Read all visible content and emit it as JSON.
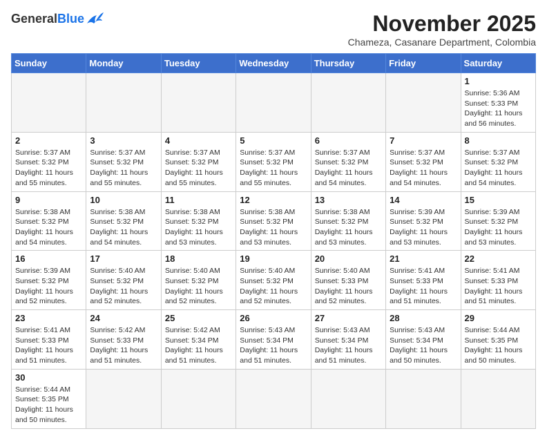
{
  "header": {
    "logo_general": "General",
    "logo_blue": "Blue",
    "month_title": "November 2025",
    "subtitle": "Chameza, Casanare Department, Colombia"
  },
  "weekdays": [
    "Sunday",
    "Monday",
    "Tuesday",
    "Wednesday",
    "Thursday",
    "Friday",
    "Saturday"
  ],
  "weeks": [
    [
      {
        "day": "",
        "empty": true
      },
      {
        "day": "",
        "empty": true
      },
      {
        "day": "",
        "empty": true
      },
      {
        "day": "",
        "empty": true
      },
      {
        "day": "",
        "empty": true
      },
      {
        "day": "",
        "empty": true
      },
      {
        "day": "1",
        "sunrise": "5:36 AM",
        "sunset": "5:33 PM",
        "daylight": "11 hours and 56 minutes."
      }
    ],
    [
      {
        "day": "2",
        "sunrise": "5:37 AM",
        "sunset": "5:32 PM",
        "daylight": "11 hours and 55 minutes."
      },
      {
        "day": "3",
        "sunrise": "5:37 AM",
        "sunset": "5:32 PM",
        "daylight": "11 hours and 55 minutes."
      },
      {
        "day": "4",
        "sunrise": "5:37 AM",
        "sunset": "5:32 PM",
        "daylight": "11 hours and 55 minutes."
      },
      {
        "day": "5",
        "sunrise": "5:37 AM",
        "sunset": "5:32 PM",
        "daylight": "11 hours and 55 minutes."
      },
      {
        "day": "6",
        "sunrise": "5:37 AM",
        "sunset": "5:32 PM",
        "daylight": "11 hours and 54 minutes."
      },
      {
        "day": "7",
        "sunrise": "5:37 AM",
        "sunset": "5:32 PM",
        "daylight": "11 hours and 54 minutes."
      },
      {
        "day": "8",
        "sunrise": "5:37 AM",
        "sunset": "5:32 PM",
        "daylight": "11 hours and 54 minutes."
      }
    ],
    [
      {
        "day": "9",
        "sunrise": "5:38 AM",
        "sunset": "5:32 PM",
        "daylight": "11 hours and 54 minutes."
      },
      {
        "day": "10",
        "sunrise": "5:38 AM",
        "sunset": "5:32 PM",
        "daylight": "11 hours and 54 minutes."
      },
      {
        "day": "11",
        "sunrise": "5:38 AM",
        "sunset": "5:32 PM",
        "daylight": "11 hours and 53 minutes."
      },
      {
        "day": "12",
        "sunrise": "5:38 AM",
        "sunset": "5:32 PM",
        "daylight": "11 hours and 53 minutes."
      },
      {
        "day": "13",
        "sunrise": "5:38 AM",
        "sunset": "5:32 PM",
        "daylight": "11 hours and 53 minutes."
      },
      {
        "day": "14",
        "sunrise": "5:39 AM",
        "sunset": "5:32 PM",
        "daylight": "11 hours and 53 minutes."
      },
      {
        "day": "15",
        "sunrise": "5:39 AM",
        "sunset": "5:32 PM",
        "daylight": "11 hours and 53 minutes."
      }
    ],
    [
      {
        "day": "16",
        "sunrise": "5:39 AM",
        "sunset": "5:32 PM",
        "daylight": "11 hours and 52 minutes."
      },
      {
        "day": "17",
        "sunrise": "5:40 AM",
        "sunset": "5:32 PM",
        "daylight": "11 hours and 52 minutes."
      },
      {
        "day": "18",
        "sunrise": "5:40 AM",
        "sunset": "5:32 PM",
        "daylight": "11 hours and 52 minutes."
      },
      {
        "day": "19",
        "sunrise": "5:40 AM",
        "sunset": "5:32 PM",
        "daylight": "11 hours and 52 minutes."
      },
      {
        "day": "20",
        "sunrise": "5:40 AM",
        "sunset": "5:33 PM",
        "daylight": "11 hours and 52 minutes."
      },
      {
        "day": "21",
        "sunrise": "5:41 AM",
        "sunset": "5:33 PM",
        "daylight": "11 hours and 51 minutes."
      },
      {
        "day": "22",
        "sunrise": "5:41 AM",
        "sunset": "5:33 PM",
        "daylight": "11 hours and 51 minutes."
      }
    ],
    [
      {
        "day": "23",
        "sunrise": "5:41 AM",
        "sunset": "5:33 PM",
        "daylight": "11 hours and 51 minutes."
      },
      {
        "day": "24",
        "sunrise": "5:42 AM",
        "sunset": "5:33 PM",
        "daylight": "11 hours and 51 minutes."
      },
      {
        "day": "25",
        "sunrise": "5:42 AM",
        "sunset": "5:34 PM",
        "daylight": "11 hours and 51 minutes."
      },
      {
        "day": "26",
        "sunrise": "5:43 AM",
        "sunset": "5:34 PM",
        "daylight": "11 hours and 51 minutes."
      },
      {
        "day": "27",
        "sunrise": "5:43 AM",
        "sunset": "5:34 PM",
        "daylight": "11 hours and 51 minutes."
      },
      {
        "day": "28",
        "sunrise": "5:43 AM",
        "sunset": "5:34 PM",
        "daylight": "11 hours and 50 minutes."
      },
      {
        "day": "29",
        "sunrise": "5:44 AM",
        "sunset": "5:35 PM",
        "daylight": "11 hours and 50 minutes."
      }
    ],
    [
      {
        "day": "30",
        "sunrise": "5:44 AM",
        "sunset": "5:35 PM",
        "daylight": "11 hours and 50 minutes."
      },
      {
        "day": "",
        "empty": true
      },
      {
        "day": "",
        "empty": true
      },
      {
        "day": "",
        "empty": true
      },
      {
        "day": "",
        "empty": true
      },
      {
        "day": "",
        "empty": true
      },
      {
        "day": "",
        "empty": true
      }
    ]
  ],
  "labels": {
    "sunrise": "Sunrise:",
    "sunset": "Sunset:",
    "daylight": "Daylight:"
  }
}
